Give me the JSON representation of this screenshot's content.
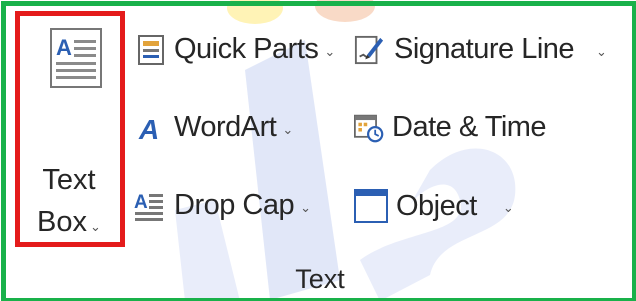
{
  "ribbon": {
    "group_label": "Text",
    "text_box": {
      "line1": "Text",
      "line2": "Box",
      "caret": "⌄",
      "icon": "text-box-icon"
    },
    "commands": {
      "quick_parts": {
        "label": "Quick Parts",
        "caret": "⌄",
        "icon": "quick-parts-icon"
      },
      "wordart": {
        "label": "WordArt",
        "caret": "⌄",
        "icon": "wordart-icon"
      },
      "drop_cap": {
        "label": "Drop Cap",
        "caret": "⌄",
        "icon": "drop-cap-icon"
      },
      "signature_line": {
        "label": "Signature Line",
        "caret": "⌄",
        "icon": "signature-line-icon"
      },
      "date_time": {
        "label": "Date & Time",
        "icon": "date-time-icon"
      },
      "object": {
        "label": "Object",
        "caret": "⌄",
        "icon": "object-icon"
      }
    }
  },
  "colors": {
    "group_outline": "#19b14a",
    "highlight_outline": "#e41b1b",
    "icon_blue": "#2b5fb3",
    "watermark": "#c9d4f3"
  }
}
